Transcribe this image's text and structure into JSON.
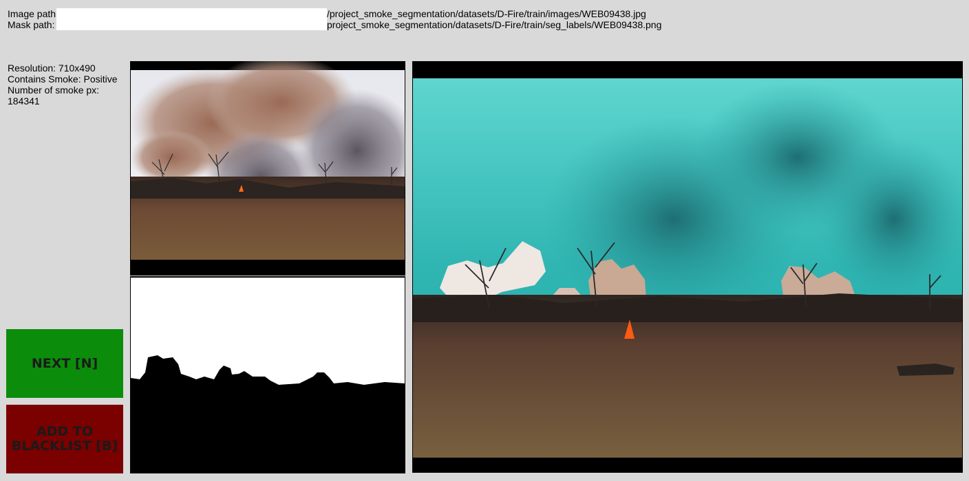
{
  "paths": {
    "image_label": "Image path",
    "image_value": "/project_smoke_segmentation/datasets/D-Fire/train/images/WEB09438.jpg",
    "mask_label": "Mask path:",
    "mask_value": "project_smoke_segmentation/datasets/D-Fire/train/seg_labels/WEB09438.png"
  },
  "info": {
    "resolution": "Resolution: 710x490",
    "contains_smoke": "Contains Smoke: Positive",
    "smoke_px_label": "Number of smoke px:",
    "smoke_px_value": "184341"
  },
  "buttons": {
    "next": "NEXT [N]",
    "blacklist": "ADD TO BLACKLIST [B]"
  },
  "colors": {
    "background": "#d9d9d9",
    "next_button": "#0b8d0b",
    "blacklist_button": "#7b0000",
    "overlay_tint": "#2ec8c4"
  }
}
